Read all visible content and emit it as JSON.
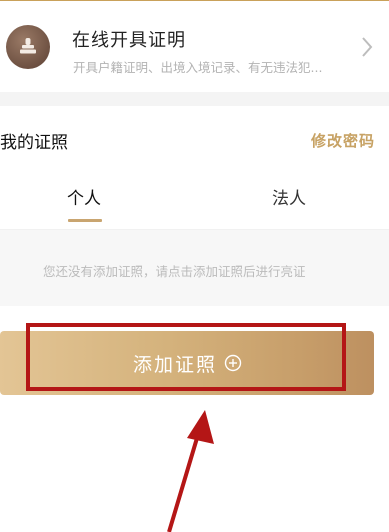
{
  "service": {
    "title": "在线开具证明",
    "description": "开具户籍证明、出境入境记录、有无违法犯..."
  },
  "my_certs": {
    "title": "我的证照",
    "modify_password": "修改密码"
  },
  "tabs": [
    {
      "label": "个人",
      "active": true
    },
    {
      "label": "法人",
      "active": false
    }
  ],
  "empty_state": "您还没有添加证照，请点击添加证照后进行亮证",
  "add_button": {
    "label": "添加证照"
  },
  "colors": {
    "accent_gold": "#c9a570",
    "annotation_red": "#b41616"
  }
}
